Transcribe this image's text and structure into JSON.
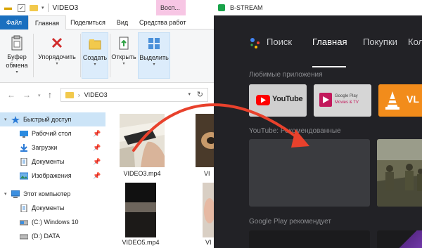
{
  "explorer": {
    "window_title": "VIDEO3",
    "context_tab": "Восп...",
    "tabs": [
      "Файл",
      "Главная",
      "Поделиться",
      "Вид",
      "Средства работ"
    ],
    "ribbon": {
      "clipboard": "Буфер обмена",
      "organize": "Упорядочить",
      "create": "Создать",
      "open": "Открыть",
      "select": "Выделить"
    },
    "address": {
      "folder": "VIDEO3"
    },
    "sidebar": [
      {
        "label": "Быстрый доступ",
        "icon": "star-icon",
        "selected": true
      },
      {
        "label": "Рабочий стол",
        "icon": "desktop-icon",
        "pinned": true
      },
      {
        "label": "Загрузки",
        "icon": "download-icon",
        "pinned": true
      },
      {
        "label": "Документы",
        "icon": "documents-icon",
        "pinned": true
      },
      {
        "label": "Изображения",
        "icon": "pictures-icon",
        "pinned": true
      },
      {
        "label": "Этот компьютер",
        "icon": "computer-icon"
      },
      {
        "label": "Документы",
        "icon": "documents-icon"
      },
      {
        "label": "(C:) Windows 10",
        "icon": "drive-icon"
      },
      {
        "label": "(D:) DATA",
        "icon": "drive-icon"
      }
    ],
    "files": [
      "VIDEO3.mp4",
      "VI",
      "VIDEO5.mp4",
      "VI"
    ]
  },
  "stream": {
    "window_title": "B-STREAM",
    "nav": [
      "Поиск",
      "Главная",
      "Покупки",
      "Кол"
    ],
    "sections": {
      "apps": "Любимые приложения",
      "youtube": "YouTube: Рекомендованные",
      "play": "Google Play рекомендует"
    },
    "apps": {
      "youtube": "YouTube",
      "play_line1": "Google Play",
      "play_line2": "Movies & TV",
      "vlc": "VL"
    }
  },
  "colors": {
    "file_tab": "#1a6fbf",
    "stream_bg": "#222226",
    "arrow": "#e8412c",
    "youtube_red": "#ff0000",
    "vlc_orange": "#f28c1b"
  }
}
